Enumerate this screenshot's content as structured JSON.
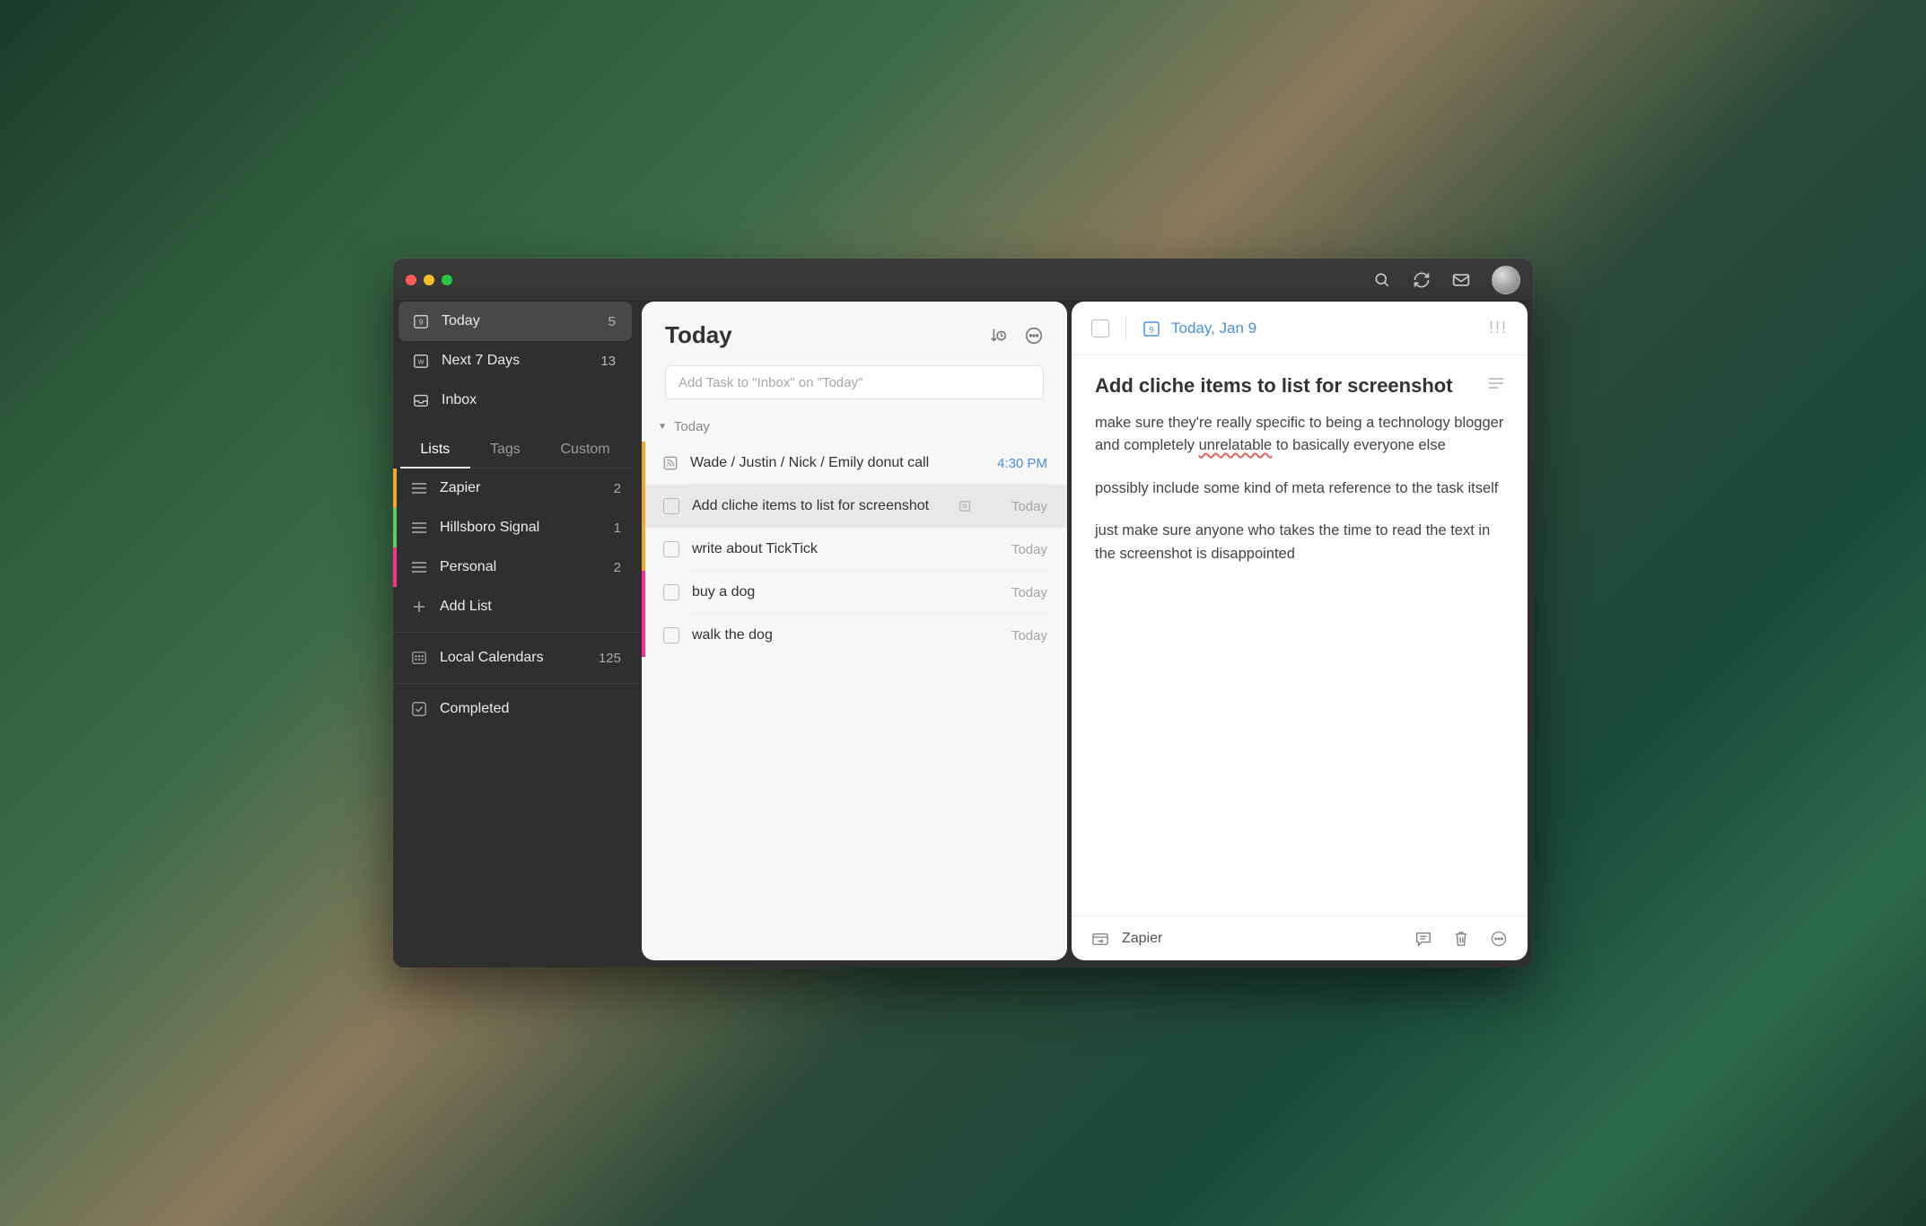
{
  "sidebar": {
    "smart": [
      {
        "label": "Today",
        "count": 5,
        "icon": "calendar-day",
        "badge": "9",
        "active": true
      },
      {
        "label": "Next 7 Days",
        "count": 13,
        "icon": "calendar-week",
        "badge": "W",
        "active": false
      },
      {
        "label": "Inbox",
        "count": "",
        "icon": "inbox",
        "active": false
      }
    ],
    "tabs": [
      "Lists",
      "Tags",
      "Custom"
    ],
    "active_tab": 0,
    "lists": [
      {
        "label": "Zapier",
        "count": 2,
        "color": "#f5a623"
      },
      {
        "label": "Hillsboro Signal",
        "count": 1,
        "color": "#5ccb5f"
      },
      {
        "label": "Personal",
        "count": 2,
        "color": "#ff2d92"
      }
    ],
    "add_list": "Add List",
    "calendar": {
      "label": "Local Calendars",
      "count": 125
    },
    "completed": "Completed"
  },
  "tasks": {
    "title": "Today",
    "add_placeholder": "Add Task to \"Inbox\" on \"Today\"",
    "group_label": "Today",
    "items": [
      {
        "title": "Wade / Justin / Nick / Emily donut call",
        "time": "4:30 PM",
        "time_blue": true,
        "color": "#f5a623",
        "icon_leading": "feed",
        "selected": false
      },
      {
        "title": "Add cliche items to list for screenshot",
        "time": "Today",
        "time_blue": false,
        "color": "#f5a623",
        "has_note": true,
        "selected": true
      },
      {
        "title": "write about TickTick",
        "time": "Today",
        "time_blue": false,
        "color": "#f5a623",
        "selected": false
      },
      {
        "title": "buy a dog",
        "time": "Today",
        "time_blue": false,
        "color": "#ff2d92",
        "selected": false
      },
      {
        "title": "walk the dog",
        "time": "Today",
        "time_blue": false,
        "color": "#ff2d92",
        "selected": false
      }
    ]
  },
  "detail": {
    "date_label": "Today, Jan 9",
    "date_badge": "9",
    "title": "Add cliche items to list for screenshot",
    "paragraphs": [
      "make sure they're really specific to being a technology blogger and completely |unrelatable| to basically everyone else",
      "possibly include some kind of meta reference to the task itself",
      "just make sure anyone who takes the time to read the text in the screenshot is disappointed"
    ],
    "project": "Zapier"
  }
}
